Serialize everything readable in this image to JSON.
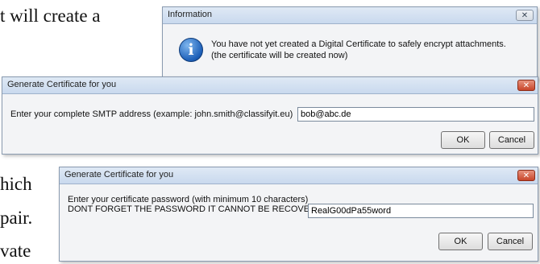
{
  "background_text": {
    "line1": "t will create a",
    "line2": "hich",
    "line3": "pair.",
    "line4": "vate"
  },
  "info_dialog": {
    "title": "Information",
    "close_label": "✕",
    "icon": "info-icon",
    "message_line1": "You have not yet created a Digital Certificate to safely encrypt attachments.",
    "message_line2": "(the certificate will be created now)"
  },
  "smtp_dialog": {
    "title": "Generate Certificate for you",
    "close_label": "✕",
    "prompt": "Enter your complete SMTP address (example: john.smith@classifyit.eu)",
    "input_value": "bob@abc.de",
    "ok_label": "OK",
    "cancel_label": "Cancel"
  },
  "password_dialog": {
    "title": "Generate Certificate for you",
    "close_label": "✕",
    "prompt_line1": "Enter your certificate password (with minimum 10 characters)",
    "prompt_line2": "DONT FORGET THE PASSWORD IT CANNOT BE RECOVERED",
    "input_value": "RealG00dPa55word",
    "ok_label": "OK",
    "cancel_label": "Cancel"
  }
}
